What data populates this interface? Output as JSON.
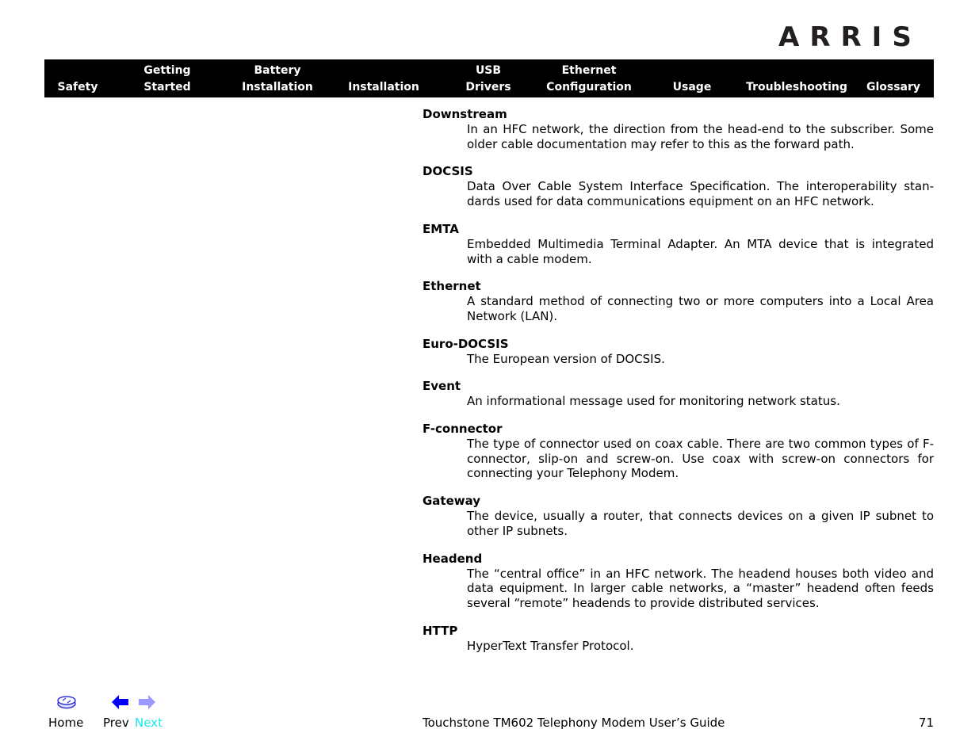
{
  "logo": {
    "text": "ARRIS"
  },
  "nav": [
    {
      "line1": "",
      "line2": "Safety"
    },
    {
      "line1": "Getting",
      "line2": "Started"
    },
    {
      "line1": "Battery",
      "line2": "Installation"
    },
    {
      "line1": "",
      "line2": "Installation"
    },
    {
      "line1": "USB",
      "line2": "Drivers"
    },
    {
      "line1": "Ethernet",
      "line2": "Configuration"
    },
    {
      "line1": "",
      "line2": "Usage"
    },
    {
      "line1": "",
      "line2": "Troubleshooting"
    },
    {
      "line1": "",
      "line2": "Glossary"
    }
  ],
  "glossary": [
    {
      "term": "Downstream",
      "definition": "In an HFC network, the direction from the head-end to the subscriber. Some older cable documentation may refer to this as the forward path."
    },
    {
      "term": "DOCSIS",
      "definition": "Data Over Cable System Interface Specification. The interoperability stan-dards used for data communications equipment on an HFC network."
    },
    {
      "term": "EMTA",
      "definition": "Embedded Multimedia Terminal Adapter. An MTA device that is integrated with a cable modem."
    },
    {
      "term": "Ethernet",
      "definition": "A standard method of connecting two or more computers into a Local Area Network (LAN)."
    },
    {
      "term": "Euro-DOCSIS",
      "definition": "The European version of DOCSIS."
    },
    {
      "term": "Event",
      "definition": "An informational message used for monitoring network status."
    },
    {
      "term": "F-connector",
      "definition": "The type of connector used on coax cable. There are two common types of F-connector, slip-on and screw-on. Use coax with screw-on connectors for connecting your Telephony Modem."
    },
    {
      "term": "Gateway",
      "definition": "The device, usually a router, that connects devices on a given IP subnet to other IP subnets."
    },
    {
      "term": "Headend",
      "definition": "The “central office” in an HFC network. The headend houses both video and data equipment. In larger cable networks, a “master” headend often feeds several “remote” headends to provide distributed services."
    },
    {
      "term": "HTTP",
      "definition": "HyperText Transfer Protocol."
    }
  ],
  "footer": {
    "home_label": "Home",
    "prev_label": "Prev",
    "next_label": "Next",
    "home_icon": "home-disc-icon",
    "prev_icon": "arrow-left-icon",
    "next_icon": "arrow-right-icon",
    "title": "Touchstone TM602 Telephony Modem User’s Guide",
    "page_number": "71"
  },
  "colors": {
    "nav_bg": "#000000",
    "nav_text": "#ffffff",
    "next_link": "#19e8f0",
    "prev_arrow": "#0000ff",
    "next_arrow": "#9999ff",
    "home_icon": "#3333dd"
  }
}
